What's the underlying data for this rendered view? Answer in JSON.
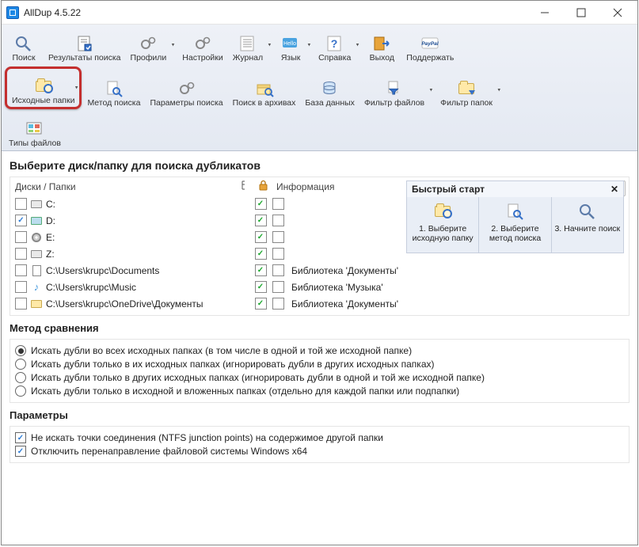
{
  "window": {
    "title": "AllDup 4.5.22"
  },
  "ribbon": {
    "row1": [
      {
        "id": "search",
        "label": "Поиск",
        "icon": "magnifier"
      },
      {
        "id": "results",
        "label": "Результаты поиска",
        "icon": "report"
      },
      {
        "id": "profiles",
        "label": "Профили",
        "icon": "gears",
        "dd": true
      },
      {
        "id": "settings",
        "label": "Настройки",
        "icon": "gears"
      },
      {
        "id": "journal",
        "label": "Журнал",
        "icon": "list",
        "dd": true
      },
      {
        "id": "lang",
        "label": "Язык",
        "icon": "hello",
        "dd": true
      },
      {
        "id": "help",
        "label": "Справка",
        "icon": "question",
        "dd": true
      },
      {
        "id": "exit",
        "label": "Выход",
        "icon": "exit"
      },
      {
        "id": "support",
        "label": "Поддержать",
        "icon": "paypal"
      }
    ],
    "row2": [
      {
        "id": "source",
        "label": "Исходные папки",
        "icon": "folder-magnify",
        "dd": true,
        "highlight": true
      },
      {
        "id": "method",
        "label": "Метод поиска",
        "icon": "doc-magnify"
      },
      {
        "id": "params",
        "label": "Параметры поиска",
        "icon": "gears"
      },
      {
        "id": "archives",
        "label": "Поиск в архивах",
        "icon": "archive-search"
      },
      {
        "id": "db",
        "label": "База данных",
        "icon": "database"
      },
      {
        "id": "ffilter",
        "label": "Фильтр файлов",
        "icon": "file-filter",
        "dd": true
      },
      {
        "id": "dfilter",
        "label": "Фильтр папок",
        "icon": "folder-filter",
        "dd": true
      }
    ],
    "row3": [
      {
        "id": "types",
        "label": "Типы файлов",
        "icon": "filetypes"
      }
    ]
  },
  "main": {
    "heading": "Выберите диск/папку для поиска дубликатов",
    "columns": {
      "path": "Диски / Папки",
      "info": "Информация"
    },
    "rows": [
      {
        "sel": false,
        "icon": "disk",
        "path": "C:",
        "tree": true,
        "lock": false,
        "info": ""
      },
      {
        "sel": true,
        "icon": "hdd",
        "path": "D:",
        "tree": true,
        "lock": false,
        "info": ""
      },
      {
        "sel": false,
        "icon": "cd",
        "path": "E:",
        "tree": true,
        "lock": false,
        "info": ""
      },
      {
        "sel": false,
        "icon": "disk",
        "path": "Z:",
        "tree": true,
        "lock": false,
        "info": ""
      },
      {
        "sel": false,
        "icon": "doc",
        "path": "C:\\Users\\krupc\\Documents",
        "tree": true,
        "lock": false,
        "info": "Библиотека 'Документы'"
      },
      {
        "sel": false,
        "icon": "music",
        "path": "C:\\Users\\krupc\\Music",
        "tree": true,
        "lock": false,
        "info": "Библиотека 'Музыка'"
      },
      {
        "sel": false,
        "icon": "folder",
        "path": "C:\\Users\\krupc\\OneDrive\\Документы",
        "tree": true,
        "lock": false,
        "info": "Библиотека 'Документы'"
      }
    ]
  },
  "quick": {
    "title": "Быстрый старт",
    "steps": [
      {
        "label": "1. Выберите исходную папку",
        "icon": "folder-magnify"
      },
      {
        "label": "2. Выберите метод поиска",
        "icon": "doc-magnify"
      },
      {
        "label": "3. Начните поиск",
        "icon": "magnifier"
      }
    ]
  },
  "compare": {
    "title": "Метод сравнения",
    "options": [
      {
        "sel": true,
        "label": "Искать дубли во всех исходных папках (в том числе в одной и той же исходной папке)"
      },
      {
        "sel": false,
        "label": "Искать дубли только в их исходных папках (игнорировать дубли в других исходных папках)"
      },
      {
        "sel": false,
        "label": "Искать дубли только в других исходных папках (игнорировать дубли в одной и той же исходной папке)"
      },
      {
        "sel": false,
        "label": "Искать дубли только в исходной и вложенных папках (отдельно для каждой папки или подпапки)"
      }
    ]
  },
  "params": {
    "title": "Параметры",
    "options": [
      {
        "sel": true,
        "label": "Не искать точки соединения (NTFS junction points) на содержимое другой папки"
      },
      {
        "sel": true,
        "label": "Отключить перенаправление файловой системы Windows x64"
      }
    ]
  },
  "icons": {
    "tree_header": "↳",
    "lock_header": "🔒"
  }
}
